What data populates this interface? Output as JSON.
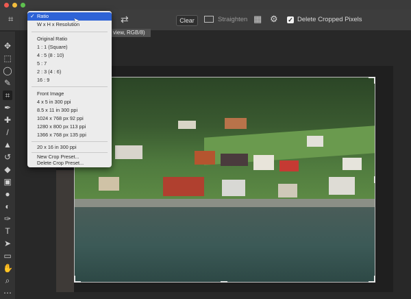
{
  "window": {
    "traffic_lights": [
      {
        "name": "close",
        "color": "#ee5a51"
      },
      {
        "name": "minimize",
        "color": "#f2bd3d"
      },
      {
        "name": "maximize",
        "color": "#5ec14f"
      }
    ]
  },
  "options_bar": {
    "clear_label": "Clear",
    "straighten_label": "Straighten",
    "delete_cropped_checked": true,
    "delete_cropped_label": "Delete Cropped Pixels"
  },
  "document": {
    "tab_fragment": "view, RGB/8)"
  },
  "ratio_menu": {
    "items": [
      {
        "label": "Ratio",
        "selected": true
      },
      {
        "label": "W x H x Resolution"
      }
    ],
    "group_original": [
      {
        "label": "Original Ratio"
      },
      {
        "label": "1 : 1 (Square)"
      },
      {
        "label": "4 : 5 (8 : 10)"
      },
      {
        "label": "5 : 7"
      },
      {
        "label": "2 : 3 (4 : 6)"
      },
      {
        "label": "16 : 9"
      }
    ],
    "group_image": [
      {
        "label": "Front Image"
      },
      {
        "label": "4 x 5 in 300 ppi"
      },
      {
        "label": "8.5 x 11 in 300 ppi"
      },
      {
        "label": "1024 x 768 px 92 ppi"
      },
      {
        "label": "1280 x 800 px 113 ppi"
      },
      {
        "label": "1366 x 768 px 135 ppi"
      }
    ],
    "group_custom": [
      {
        "label": "20 x 16 in 300 ppi"
      }
    ],
    "group_actions": [
      {
        "label": "New Crop Preset..."
      },
      {
        "label": "Delete Crop Preset..."
      }
    ]
  },
  "tools": [
    "move-icon",
    "marquee-icon",
    "lasso-icon",
    "quick-select-icon",
    "crop-icon",
    "eyedropper-icon",
    "healing-icon",
    "brush-icon",
    "stamp-icon",
    "history-brush-icon",
    "eraser-icon",
    "gradient-icon",
    "blur-icon",
    "dodge-icon",
    "pen-icon",
    "type-icon",
    "path-select-icon",
    "rectangle-icon",
    "hand-icon",
    "zoom-icon"
  ]
}
